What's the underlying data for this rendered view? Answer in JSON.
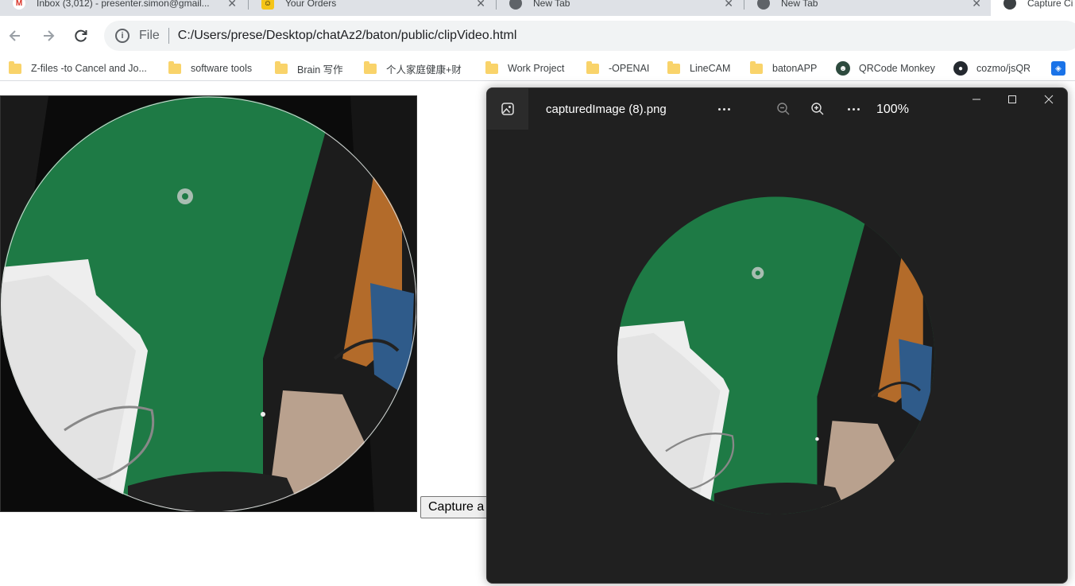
{
  "browser": {
    "tabs": [
      {
        "title": "Inbox (3,012) - presenter.simon@gmail...",
        "favicon": "gmail-icon",
        "active": false
      },
      {
        "title": "Your Orders",
        "favicon": "shop-icon",
        "active": false
      },
      {
        "title": "New Tab",
        "favicon": "chrome-icon",
        "active": false
      },
      {
        "title": "New Tab",
        "favicon": "chrome-icon",
        "active": false
      },
      {
        "title": "Capture Ci",
        "favicon": "chrome-icon",
        "active": true
      }
    ],
    "omnibox": {
      "scheme_label": "File",
      "url": "C:/Users/prese/Desktop/chatAz2/baton/public/clipVideo.html"
    },
    "bookmarks": [
      {
        "label": "Z-files -to Cancel and Jo...",
        "icon": "folder-icon"
      },
      {
        "label": "software tools",
        "icon": "folder-icon"
      },
      {
        "label": "Brain 写作",
        "icon": "folder-icon"
      },
      {
        "label": "个人家庭健康+财",
        "icon": "folder-icon"
      },
      {
        "label": "Work Project",
        "icon": "folder-icon"
      },
      {
        "label": "-OPENAI",
        "icon": "folder-icon"
      },
      {
        "label": "LineCAM",
        "icon": "folder-icon"
      },
      {
        "label": "batonAPP",
        "icon": "folder-icon"
      },
      {
        "label": "QRCode Monkey",
        "icon": "monkey-icon"
      },
      {
        "label": "cozmo/jsQR",
        "icon": "github-icon"
      }
    ]
  },
  "page": {
    "capture_button_label": "Capture a"
  },
  "viewer": {
    "file_name": "capturedImage (8).png",
    "zoom_label": "100%"
  },
  "colors": {
    "accent_green": "#1e7a45",
    "viewer_bg": "#202020",
    "tabstrip_bg": "#dee1e6"
  }
}
